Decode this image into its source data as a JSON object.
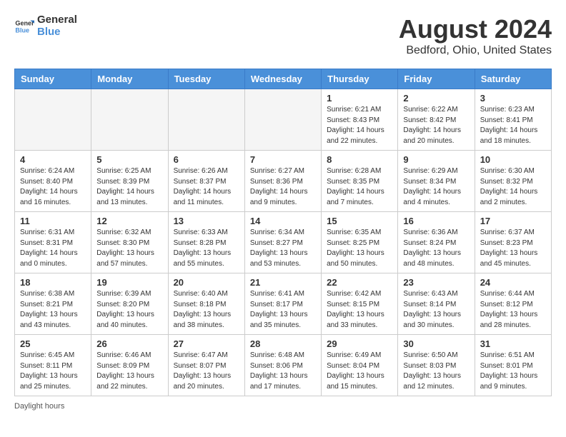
{
  "header": {
    "logo_line1": "General",
    "logo_line2": "Blue",
    "main_title": "August 2024",
    "subtitle": "Bedford, Ohio, United States"
  },
  "days_of_week": [
    "Sunday",
    "Monday",
    "Tuesday",
    "Wednesday",
    "Thursday",
    "Friday",
    "Saturday"
  ],
  "weeks": [
    [
      {
        "day": "",
        "info": ""
      },
      {
        "day": "",
        "info": ""
      },
      {
        "day": "",
        "info": ""
      },
      {
        "day": "",
        "info": ""
      },
      {
        "day": "1",
        "info": "Sunrise: 6:21 AM\nSunset: 8:43 PM\nDaylight: 14 hours\nand 22 minutes."
      },
      {
        "day": "2",
        "info": "Sunrise: 6:22 AM\nSunset: 8:42 PM\nDaylight: 14 hours\nand 20 minutes."
      },
      {
        "day": "3",
        "info": "Sunrise: 6:23 AM\nSunset: 8:41 PM\nDaylight: 14 hours\nand 18 minutes."
      }
    ],
    [
      {
        "day": "4",
        "info": "Sunrise: 6:24 AM\nSunset: 8:40 PM\nDaylight: 14 hours\nand 16 minutes."
      },
      {
        "day": "5",
        "info": "Sunrise: 6:25 AM\nSunset: 8:39 PM\nDaylight: 14 hours\nand 13 minutes."
      },
      {
        "day": "6",
        "info": "Sunrise: 6:26 AM\nSunset: 8:37 PM\nDaylight: 14 hours\nand 11 minutes."
      },
      {
        "day": "7",
        "info": "Sunrise: 6:27 AM\nSunset: 8:36 PM\nDaylight: 14 hours\nand 9 minutes."
      },
      {
        "day": "8",
        "info": "Sunrise: 6:28 AM\nSunset: 8:35 PM\nDaylight: 14 hours\nand 7 minutes."
      },
      {
        "day": "9",
        "info": "Sunrise: 6:29 AM\nSunset: 8:34 PM\nDaylight: 14 hours\nand 4 minutes."
      },
      {
        "day": "10",
        "info": "Sunrise: 6:30 AM\nSunset: 8:32 PM\nDaylight: 14 hours\nand 2 minutes."
      }
    ],
    [
      {
        "day": "11",
        "info": "Sunrise: 6:31 AM\nSunset: 8:31 PM\nDaylight: 14 hours\nand 0 minutes."
      },
      {
        "day": "12",
        "info": "Sunrise: 6:32 AM\nSunset: 8:30 PM\nDaylight: 13 hours\nand 57 minutes."
      },
      {
        "day": "13",
        "info": "Sunrise: 6:33 AM\nSunset: 8:28 PM\nDaylight: 13 hours\nand 55 minutes."
      },
      {
        "day": "14",
        "info": "Sunrise: 6:34 AM\nSunset: 8:27 PM\nDaylight: 13 hours\nand 53 minutes."
      },
      {
        "day": "15",
        "info": "Sunrise: 6:35 AM\nSunset: 8:25 PM\nDaylight: 13 hours\nand 50 minutes."
      },
      {
        "day": "16",
        "info": "Sunrise: 6:36 AM\nSunset: 8:24 PM\nDaylight: 13 hours\nand 48 minutes."
      },
      {
        "day": "17",
        "info": "Sunrise: 6:37 AM\nSunset: 8:23 PM\nDaylight: 13 hours\nand 45 minutes."
      }
    ],
    [
      {
        "day": "18",
        "info": "Sunrise: 6:38 AM\nSunset: 8:21 PM\nDaylight: 13 hours\nand 43 minutes."
      },
      {
        "day": "19",
        "info": "Sunrise: 6:39 AM\nSunset: 8:20 PM\nDaylight: 13 hours\nand 40 minutes."
      },
      {
        "day": "20",
        "info": "Sunrise: 6:40 AM\nSunset: 8:18 PM\nDaylight: 13 hours\nand 38 minutes."
      },
      {
        "day": "21",
        "info": "Sunrise: 6:41 AM\nSunset: 8:17 PM\nDaylight: 13 hours\nand 35 minutes."
      },
      {
        "day": "22",
        "info": "Sunrise: 6:42 AM\nSunset: 8:15 PM\nDaylight: 13 hours\nand 33 minutes."
      },
      {
        "day": "23",
        "info": "Sunrise: 6:43 AM\nSunset: 8:14 PM\nDaylight: 13 hours\nand 30 minutes."
      },
      {
        "day": "24",
        "info": "Sunrise: 6:44 AM\nSunset: 8:12 PM\nDaylight: 13 hours\nand 28 minutes."
      }
    ],
    [
      {
        "day": "25",
        "info": "Sunrise: 6:45 AM\nSunset: 8:11 PM\nDaylight: 13 hours\nand 25 minutes."
      },
      {
        "day": "26",
        "info": "Sunrise: 6:46 AM\nSunset: 8:09 PM\nDaylight: 13 hours\nand 22 minutes."
      },
      {
        "day": "27",
        "info": "Sunrise: 6:47 AM\nSunset: 8:07 PM\nDaylight: 13 hours\nand 20 minutes."
      },
      {
        "day": "28",
        "info": "Sunrise: 6:48 AM\nSunset: 8:06 PM\nDaylight: 13 hours\nand 17 minutes."
      },
      {
        "day": "29",
        "info": "Sunrise: 6:49 AM\nSunset: 8:04 PM\nDaylight: 13 hours\nand 15 minutes."
      },
      {
        "day": "30",
        "info": "Sunrise: 6:50 AM\nSunset: 8:03 PM\nDaylight: 13 hours\nand 12 minutes."
      },
      {
        "day": "31",
        "info": "Sunrise: 6:51 AM\nSunset: 8:01 PM\nDaylight: 13 hours\nand 9 minutes."
      }
    ]
  ],
  "footer": {
    "daylight_label": "Daylight hours"
  }
}
